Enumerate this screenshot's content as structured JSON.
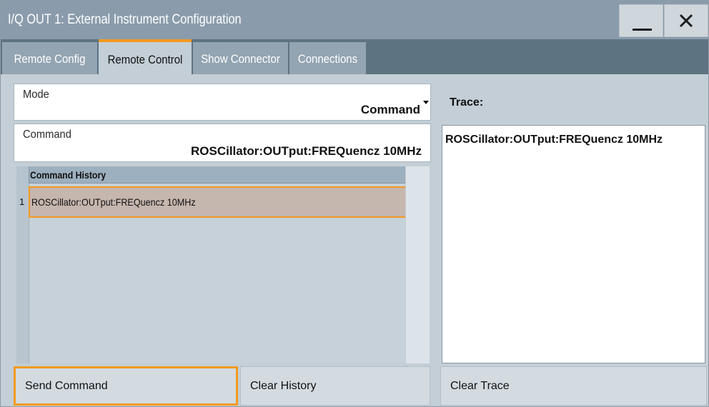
{
  "window": {
    "title": "I/Q OUT 1: External Instrument Configuration",
    "minimize_icon": "minimize-icon",
    "close_icon": "close-icon"
  },
  "tabs": [
    {
      "label": "Remote Config",
      "active": false
    },
    {
      "label": "Remote Control",
      "active": true
    },
    {
      "label": "Show Connector",
      "active": false
    },
    {
      "label": "Connections",
      "active": false
    }
  ],
  "mode": {
    "label": "Mode",
    "value": "Command"
  },
  "command": {
    "label": "Command",
    "value": "ROSCillator:OUTput:FREQuencz 10MHz"
  },
  "history": {
    "header": "Command History",
    "rows": [
      {
        "num": "1",
        "text": "ROSCillator:OUTput:FREQuencz 10MHz",
        "selected": true
      }
    ]
  },
  "trace": {
    "label": "Trace:",
    "lines": [
      "ROSCillator:OUTput:FREQuencz 10MHz"
    ]
  },
  "buttons": {
    "send": "Send Command",
    "clear_history": "Clear History",
    "clear_trace": "Clear Trace"
  },
  "colors": {
    "accent": "#f39a1e",
    "titlebar": "#8a9cac",
    "tabbar": "#5e7381",
    "background": "#c3ced6",
    "selected_row": "#c5b6ae"
  }
}
